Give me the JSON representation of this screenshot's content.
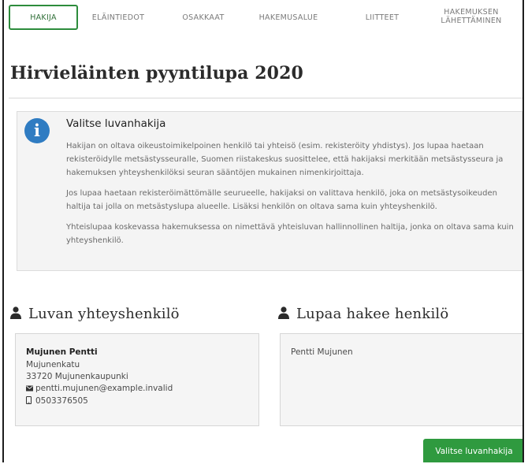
{
  "tabs": [
    {
      "label": "HAKIJA",
      "active": true
    },
    {
      "label": "ELÄINTIEDOT"
    },
    {
      "label": "OSAKKAAT"
    },
    {
      "label": "HAKEMUSALUE"
    },
    {
      "label": "LIITTEET"
    },
    {
      "label": "HAKEMUKSEN",
      "label2": "LÄHETTÄMINEN"
    }
  ],
  "page_title": "Hirvieläinten pyyntilupa 2020",
  "info": {
    "icon": "info-icon",
    "title": "Valitse luvanhakija",
    "paragraphs": [
      "Hakijan on oltava oikeustoimikelpoinen henkilö tai yhteisö (esim. rekisteröity yhdistys). Jos lupaa haetaan rekisteröidylle metsästysseuralle, Suomen riistakeskus suosittelee, että hakijaksi merkitään metsästysseura ja hakemuksen yhteyshenkilöksi seuran sääntöjen mukainen nimenkirjoittaja.",
      "Jos lupaa haetaan rekisteröimättömälle seurueelle, hakijaksi on valittava henkilö, joka on metsästysoikeuden haltija tai jolla on metsästyslupa alueelle. Lisäksi henkilön on oltava sama kuin yhteyshenkilö.",
      "Yhteislupaa koskevassa hakemuksessa on nimettävä yhteisluvan hallinnollinen haltija, jonka on oltava sama kuin yhteyshenkilö."
    ]
  },
  "contact": {
    "heading": "Luvan yhteyshenkilö",
    "name": "Mujunen Pentti",
    "street": "Mujunenkatu",
    "city": "33720 Mujunenkaupunki",
    "email": "pentti.mujunen@example.invalid",
    "phone": "0503376505"
  },
  "applicant": {
    "heading": "Lupaa hakee henkilö",
    "name": "Pentti Mujunen"
  },
  "select_button": "Valitse luvanhakija",
  "colors": {
    "accent": "#2f9a3f",
    "info": "#2f7cc2"
  }
}
